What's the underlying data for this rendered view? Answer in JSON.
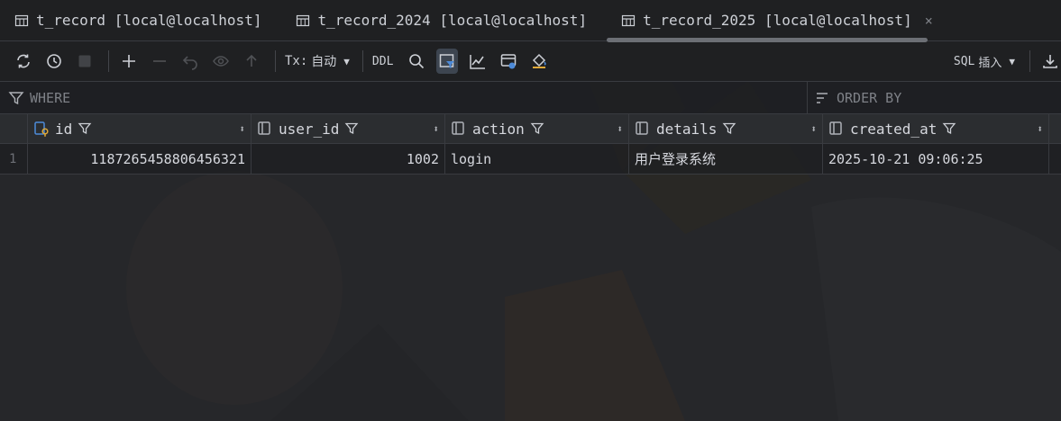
{
  "tabs": [
    {
      "label": "t_record [local@localhost]"
    },
    {
      "label": "t_record_2024 [local@localhost]"
    },
    {
      "label": "t_record_2025 [local@localhost]",
      "close": "×"
    }
  ],
  "toolbar": {
    "tx_label": "Tx:",
    "tx_mode": "自动",
    "ddl_label": "DDL",
    "sql_label": "SQL",
    "sql_mode": "插入"
  },
  "filters": {
    "where_label": "WHERE",
    "order_label": "ORDER BY"
  },
  "columns": [
    "id",
    "user_id",
    "action",
    "details",
    "created_at"
  ],
  "rows": [
    {
      "num": "1",
      "id": "1187265458806456321",
      "user_id": "1002",
      "action": "login",
      "details": "用户登录系统",
      "created_at": "2025-10-21 09:06:25"
    }
  ],
  "colors": {
    "background": "#26272a",
    "accent": "#4d8bd9",
    "key_icon": "#e0a938"
  }
}
